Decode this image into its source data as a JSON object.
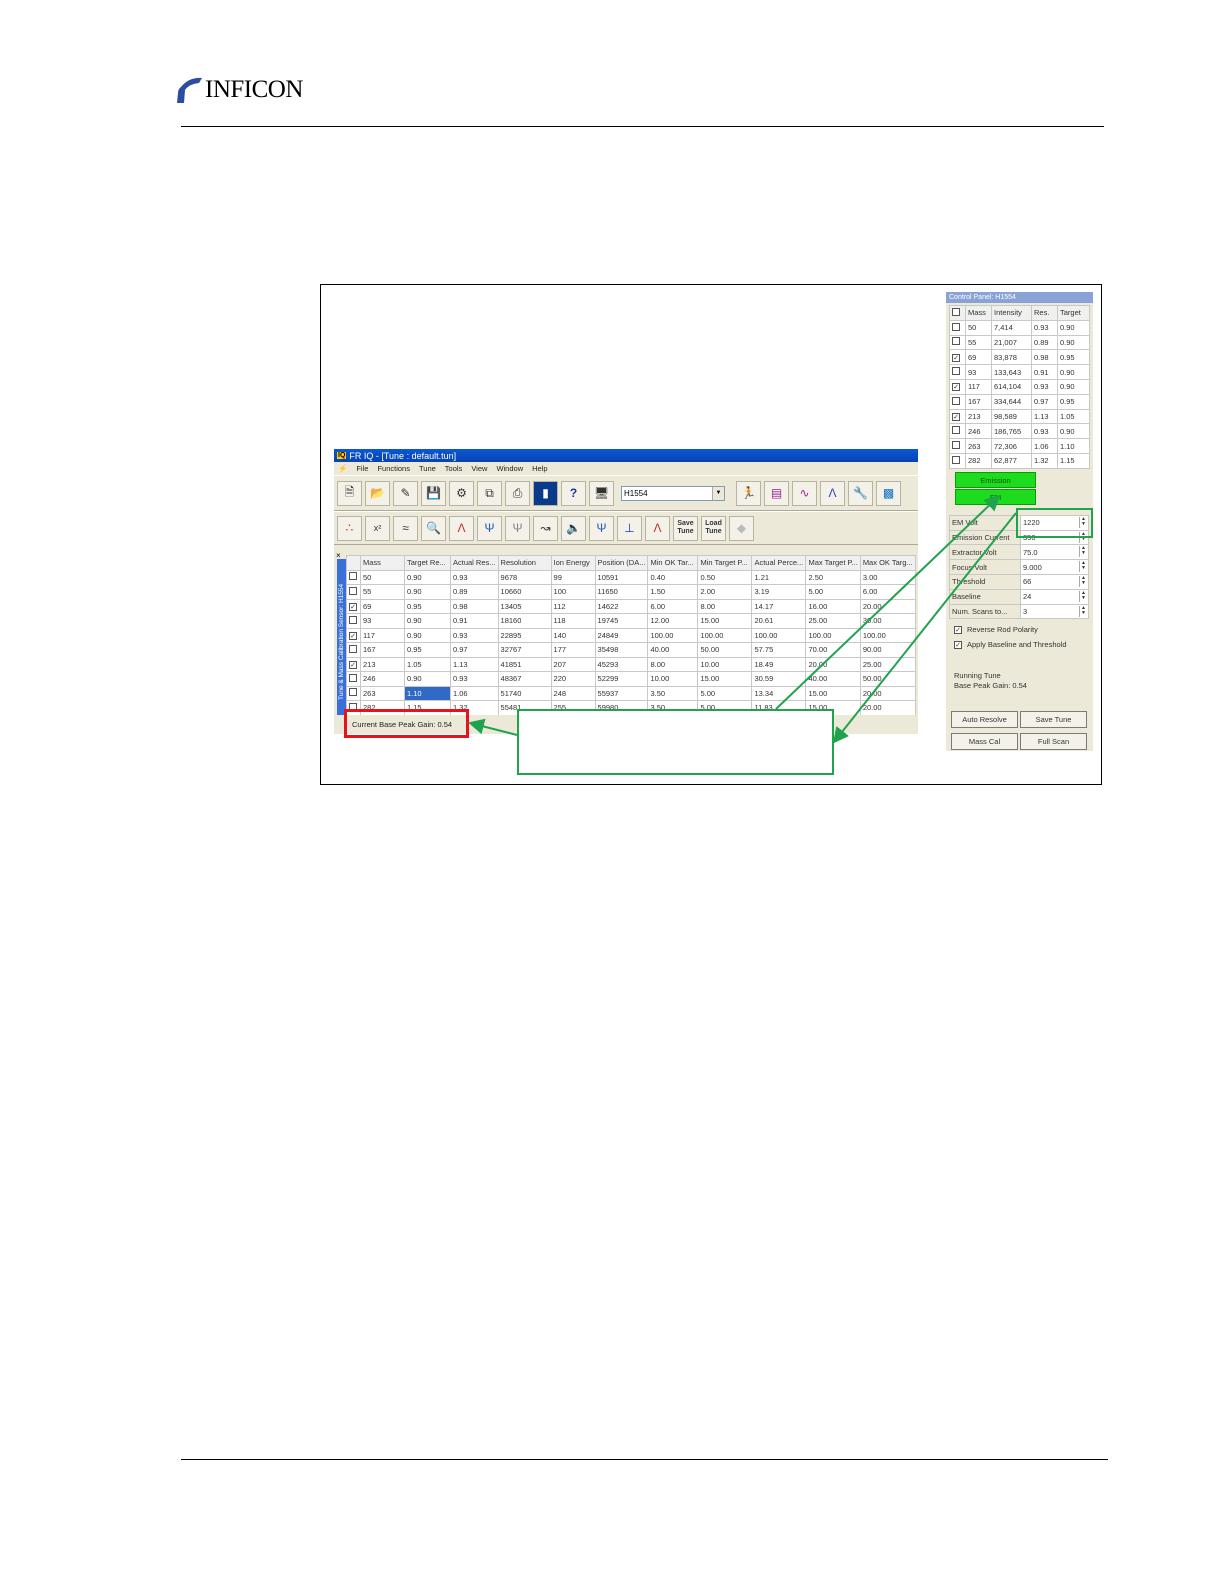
{
  "header": {
    "logo_text": "INFICON"
  },
  "app": {
    "title": "FR IQ - [Tune : default.tun]",
    "icon_label": "IQ",
    "menu": [
      "File",
      "Functions",
      "Tune",
      "Tools",
      "View",
      "Window",
      "Help"
    ],
    "device_combo": "H1554",
    "save_tune_label": "Save Tune",
    "load_tune_label": "Load Tune",
    "side_tab_label": "Tune & Mass Calibration Sensor: H1554",
    "close_label": "×",
    "table": {
      "columns": [
        "Mass",
        "Target Re...",
        "Actual Res...",
        "Resolution",
        "Ion Energy",
        "Position (DA...",
        "Min OK Tar...",
        "Min Target P...",
        "Actual Perce...",
        "Max Target P...",
        "Max OK Targ..."
      ],
      "rows": [
        {
          "checked": false,
          "cells": [
            "50",
            "0.90",
            "0.93",
            "9678",
            "99",
            "10591",
            "0.40",
            "0.50",
            "1.21",
            "2.50",
            "3.00"
          ]
        },
        {
          "checked": false,
          "cells": [
            "55",
            "0.90",
            "0.89",
            "10660",
            "100",
            "11650",
            "1.50",
            "2.00",
            "3.19",
            "5.00",
            "6.00"
          ]
        },
        {
          "checked": true,
          "cells": [
            "69",
            "0.95",
            "0.98",
            "13405",
            "112",
            "14622",
            "6.00",
            "8.00",
            "14.17",
            "16.00",
            "20.00"
          ]
        },
        {
          "checked": false,
          "cells": [
            "93",
            "0.90",
            "0.91",
            "18160",
            "118",
            "19745",
            "12.00",
            "15.00",
            "20.61",
            "25.00",
            "30.00"
          ]
        },
        {
          "checked": true,
          "cells": [
            "117",
            "0.90",
            "0.93",
            "22895",
            "140",
            "24849",
            "100.00",
            "100.00",
            "100.00",
            "100.00",
            "100.00"
          ]
        },
        {
          "checked": false,
          "cells": [
            "167",
            "0.95",
            "0.97",
            "32767",
            "177",
            "35498",
            "40.00",
            "50.00",
            "57.75",
            "70.00",
            "90.00"
          ]
        },
        {
          "checked": true,
          "cells": [
            "213",
            "1.05",
            "1.13",
            "41851",
            "207",
            "45293",
            "8.00",
            "10.00",
            "18.49",
            "20.00",
            "25.00"
          ]
        },
        {
          "checked": false,
          "cells": [
            "246",
            "0.90",
            "0.93",
            "48367",
            "220",
            "52299",
            "10.00",
            "15.00",
            "30.59",
            "40.00",
            "50.00"
          ]
        },
        {
          "checked": false,
          "cells": [
            "263",
            "1.10",
            "1.06",
            "51740",
            "248",
            "55937",
            "3.50",
            "5.00",
            "13.34",
            "15.00",
            "20.00"
          ]
        },
        {
          "checked": false,
          "cells": [
            "282",
            "1.15",
            "1.32",
            "55481",
            "255",
            "59980",
            "3.50",
            "5.00",
            "11.83",
            "15.00",
            "20.00"
          ]
        }
      ]
    },
    "status": "Current Base Peak Gain: 0.54"
  },
  "control_panel": {
    "title": "Control Panel: H1554",
    "columns": [
      "Mass",
      "Intensity",
      "Res.",
      "Target"
    ],
    "rows": [
      {
        "checked": false,
        "mass": "50",
        "intensity": "7,414",
        "res": "0.93",
        "target": "0.90"
      },
      {
        "checked": false,
        "mass": "55",
        "intensity": "21,007",
        "res": "0.89",
        "target": "0.90"
      },
      {
        "checked": true,
        "mass": "69",
        "intensity": "83,878",
        "res": "0.98",
        "target": "0.95"
      },
      {
        "checked": false,
        "mass": "93",
        "intensity": "133,643",
        "res": "0.91",
        "target": "0.90"
      },
      {
        "checked": true,
        "mass": "117",
        "intensity": "614,104",
        "res": "0.93",
        "target": "0.90"
      },
      {
        "checked": false,
        "mass": "167",
        "intensity": "334,644",
        "res": "0.97",
        "target": "0.95"
      },
      {
        "checked": true,
        "mass": "213",
        "intensity": "98,589",
        "res": "1.13",
        "target": "1.05"
      },
      {
        "checked": false,
        "mass": "246",
        "intensity": "186,765",
        "res": "0.93",
        "target": "0.90"
      },
      {
        "checked": false,
        "mass": "263",
        "intensity": "72,306",
        "res": "1.06",
        "target": "1.10"
      },
      {
        "checked": false,
        "mass": "282",
        "intensity": "62,877",
        "res": "1.32",
        "target": "1.15"
      }
    ],
    "emission_label": "Emission",
    "em_label": "EM",
    "params": [
      {
        "label": "EM Volt",
        "value": "1220"
      },
      {
        "label": "Emission Current",
        "value": "350"
      },
      {
        "label": "Extractor Volt",
        "value": "75.0"
      },
      {
        "label": "Focus Volt",
        "value": "9.000"
      },
      {
        "label": "Threshold",
        "value": "66"
      },
      {
        "label": "Baseline",
        "value": "24"
      },
      {
        "label": "Num. Scans to...",
        "value": "3"
      }
    ],
    "reverse_rod": "Reverse Rod Polarity",
    "apply_baseline": "Apply Baseline and Threshold",
    "running_tune": "Running Tune",
    "base_peak_gain": "Base Peak Gain: 0.54",
    "buttons": {
      "auto_resolve": "Auto Resolve",
      "save_tune": "Save Tune",
      "mass_cal": "Mass Cal",
      "full_scan": "Full Scan"
    }
  },
  "colors": {
    "highlight_red": "#e3141b",
    "callout_green": "#21a34d",
    "emission_green": "#1ddb1d",
    "title_blue": "#0a58d6"
  }
}
